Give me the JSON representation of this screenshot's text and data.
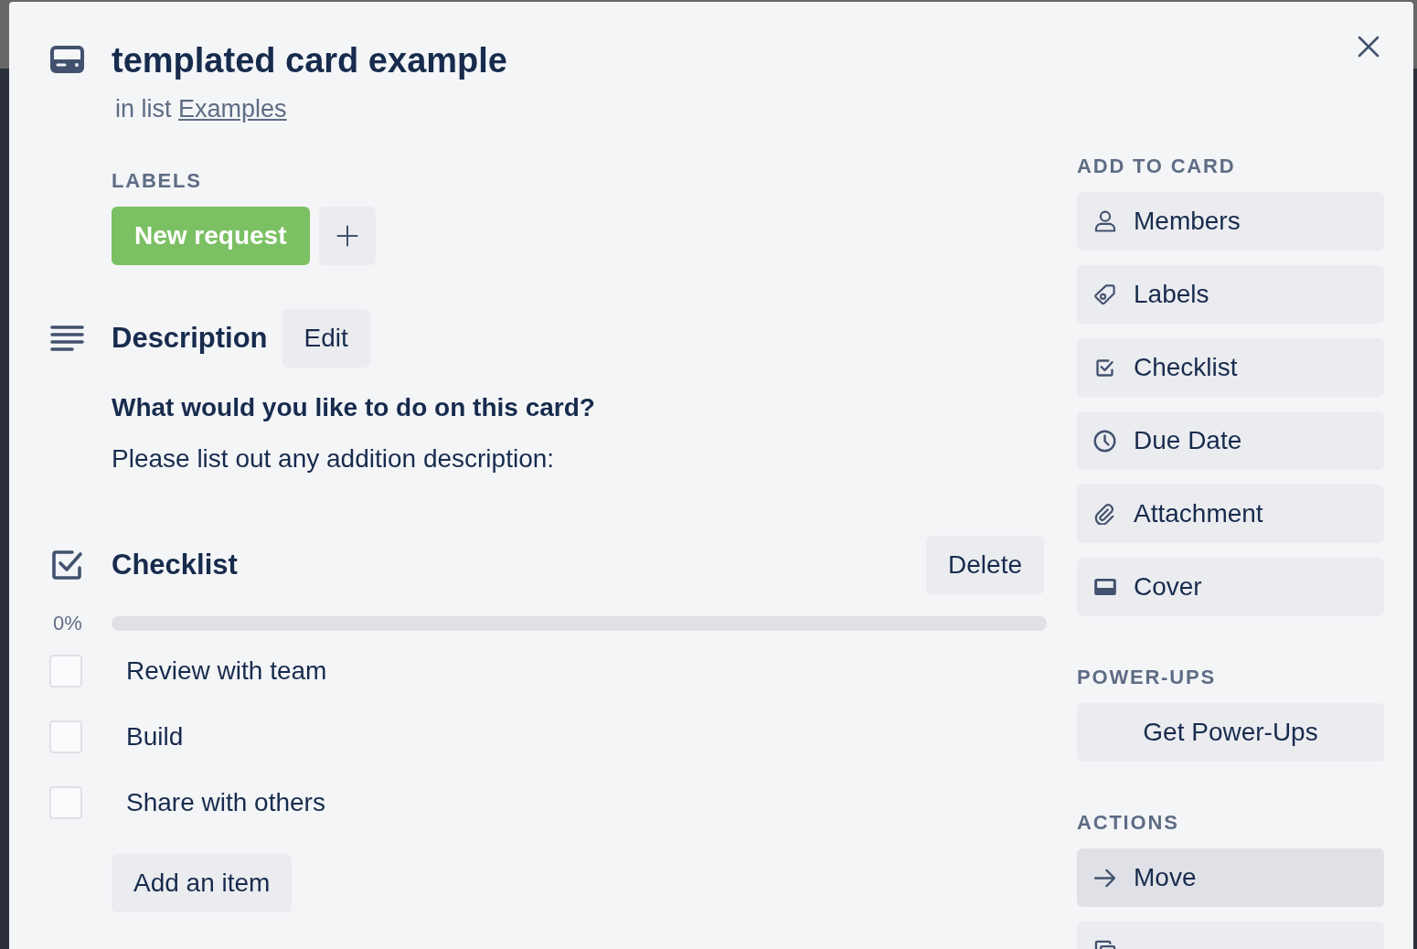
{
  "card": {
    "title": "templated card example",
    "list_prefix": "in list",
    "list_name": "Examples"
  },
  "labels": {
    "heading": "LABELS",
    "items": [
      {
        "text": "New request",
        "color": "#7bc062"
      }
    ]
  },
  "description": {
    "heading": "Description",
    "edit_button": "Edit",
    "paragraphs": [
      {
        "kind": "bold",
        "text": "What would you like to do on this card?"
      },
      {
        "kind": "plain",
        "text": "Please list out any addition description:"
      }
    ]
  },
  "checklist": {
    "heading": "Checklist",
    "delete_button": "Delete",
    "progress": {
      "reading": "0%",
      "level": 0
    },
    "items": [
      {
        "text": "Review with team",
        "checked": false
      },
      {
        "text": "Build",
        "checked": false
      },
      {
        "text": "Share with others",
        "checked": false
      }
    ],
    "add_button": "Add an item"
  },
  "sidebar": {
    "sections": [
      {
        "heading": "ADD TO CARD",
        "buttons": [
          {
            "kind": "members",
            "label": "Members",
            "highlighted": false
          },
          {
            "kind": "labels",
            "label": "Labels",
            "highlighted": false
          },
          {
            "kind": "checklist",
            "label": "Checklist",
            "highlighted": false
          },
          {
            "kind": "due_date",
            "label": "Due Date",
            "highlighted": false
          },
          {
            "kind": "attachment",
            "label": "Attachment",
            "highlighted": false
          },
          {
            "kind": "cover",
            "label": "Cover",
            "highlighted": false
          }
        ]
      },
      {
        "heading": "POWER-UPS",
        "buttons": [
          {
            "kind": "plain",
            "label": "Get Power-Ups",
            "highlighted": false
          }
        ]
      },
      {
        "heading": "ACTIONS",
        "buttons": [
          {
            "kind": "move",
            "label": "Move",
            "highlighted": true
          },
          {
            "kind": "copy",
            "highlighted": false
          }
        ]
      }
    ]
  }
}
